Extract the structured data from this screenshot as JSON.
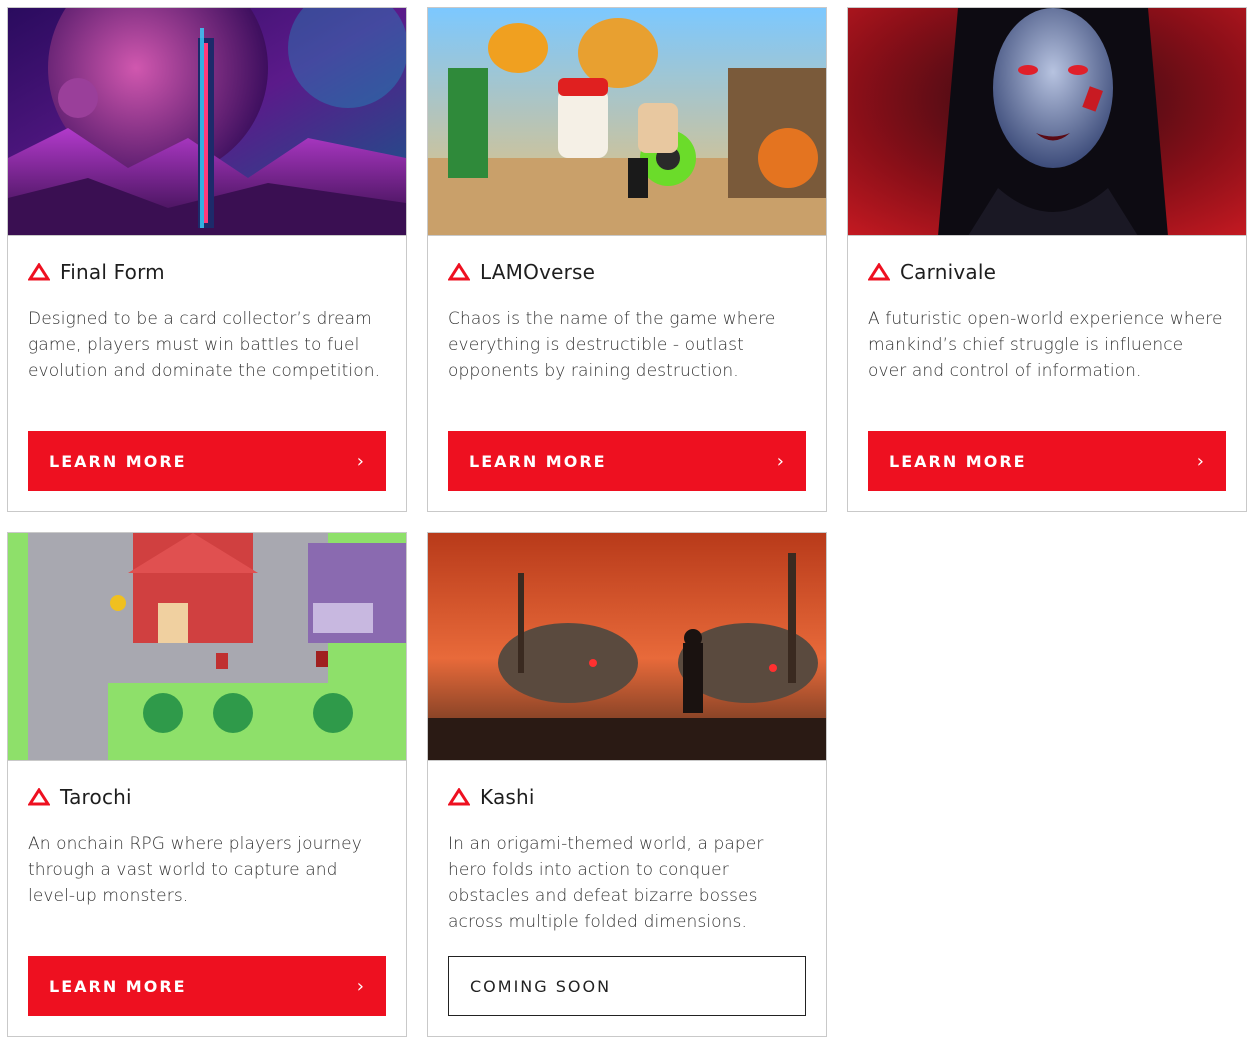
{
  "colors": {
    "accent": "#ee1020",
    "border": "#c9c9c9",
    "text": "#333333"
  },
  "cards": [
    {
      "title": "Final Form",
      "description": "Designed to be a card collector’s dream game, players must win battles to fuel evolution and dominate the competition.",
      "button_label": "LEARN MORE",
      "button_icon": "chevron-right-icon",
      "button_style": "filled"
    },
    {
      "title": "LAMOverse",
      "description": "Chaos is the name of the game where everything is destructible - outlast opponents by raining destruction.",
      "button_label": "LEARN MORE",
      "button_icon": "chevron-right-icon",
      "button_style": "filled"
    },
    {
      "title": "Carnivale",
      "description": "A futuristic open-world experience where mankind’s chief struggle is influence over and control of information.",
      "button_label": "LEARN MORE",
      "button_icon": "chevron-right-icon",
      "button_style": "filled"
    },
    {
      "title": "Tarochi",
      "description": "An onchain RPG where players journey through a vast world to capture and level-up monsters.",
      "button_label": "LEARN MORE",
      "button_icon": "chevron-right-icon",
      "button_style": "filled"
    },
    {
      "title": "Kashi",
      "description": "In an origami-themed world, a paper hero folds into action to conquer obstacles and defeat bizarre bosses across multiple folded dimensions.",
      "button_label": "COMING SOON",
      "button_style": "outline"
    }
  ],
  "chevron_glyph": "›"
}
